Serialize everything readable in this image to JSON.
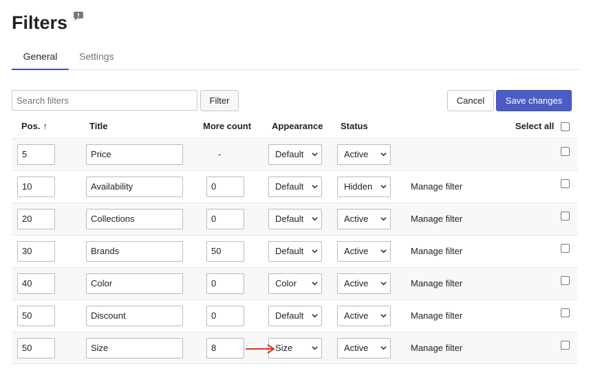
{
  "page": {
    "title": "Filters",
    "feedback_icon": "speech-bubble-exclamation-icon"
  },
  "tabs": [
    {
      "label": "General",
      "active": true
    },
    {
      "label": "Settings",
      "active": false
    }
  ],
  "toolbar": {
    "search_placeholder": "Search filters",
    "search_value": "",
    "filter_label": "Filter",
    "cancel_label": "Cancel",
    "save_label": "Save changes"
  },
  "table": {
    "headers": {
      "pos": "Pos.",
      "sort_indicator": "↑",
      "title": "Title",
      "more_count": "More count",
      "appearance": "Appearance",
      "status": "Status",
      "select_all": "Select all"
    },
    "rows": [
      {
        "pos": "5",
        "title": "Price",
        "more_count": "-",
        "appearance": "Default",
        "status": "Active",
        "manage": ""
      },
      {
        "pos": "10",
        "title": "Availability",
        "more_count": "0",
        "appearance": "Default",
        "status": "Hidden",
        "manage": "Manage filter"
      },
      {
        "pos": "20",
        "title": "Collections",
        "more_count": "0",
        "appearance": "Default",
        "status": "Active",
        "manage": "Manage filter"
      },
      {
        "pos": "30",
        "title": "Brands",
        "more_count": "50",
        "appearance": "Default",
        "status": "Active",
        "manage": "Manage filter"
      },
      {
        "pos": "40",
        "title": "Color",
        "more_count": "0",
        "appearance": "Color",
        "status": "Active",
        "manage": "Manage filter"
      },
      {
        "pos": "50",
        "title": "Discount",
        "more_count": "0",
        "appearance": "Default",
        "status": "Active",
        "manage": "Manage filter"
      },
      {
        "pos": "50",
        "title": "Size",
        "more_count": "8",
        "appearance": "Size",
        "status": "Active",
        "manage": "Manage filter"
      }
    ]
  },
  "colors": {
    "primary": "#4b5cc4",
    "tab_underline": "#3f51b5",
    "annotation_arrow": "#e0341c"
  }
}
